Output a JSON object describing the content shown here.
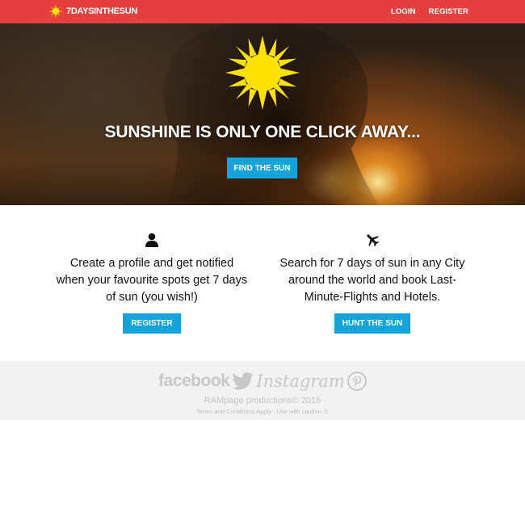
{
  "navbar": {
    "brand": "7DAYSINTHESUN",
    "links": {
      "login": "LOGIN",
      "register": "REGISTER"
    }
  },
  "hero": {
    "title": "SUNSHINE IS ONLY ONE CLICK AWAY...",
    "button": "FIND THE SUN"
  },
  "features": [
    {
      "icon": "user-icon",
      "text": "Create a profile and get notified when your favourite spots get 7 days of sun (you wish!)",
      "button": "REGISTER"
    },
    {
      "icon": "plane-icon",
      "text": "Search for 7 days of sun in any City around the world and book Last-Minute-Flights and Hotels.",
      "button": "HUNT THE SUN"
    }
  ],
  "footer": {
    "socials": {
      "facebook": "facebook",
      "instagram": "Instagram"
    },
    "copyright": "RAMpage productions© 2016",
    "terms": "Terms and Conditions Apply - Use with caution",
    "warning_glyph": "⚠"
  },
  "colors": {
    "navbar": "#e5403f",
    "button": "#16a3d9",
    "sun": "#ffe100",
    "footer_bg": "#f2f2f2"
  }
}
